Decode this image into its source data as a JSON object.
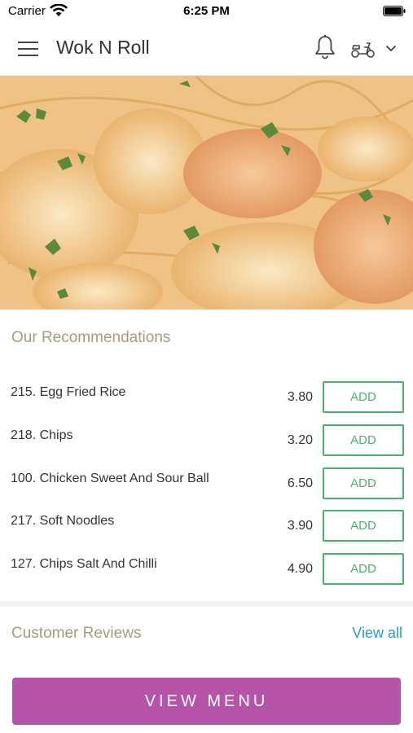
{
  "status_bar": {
    "carrier": "Carrier",
    "time": "6:25 PM"
  },
  "header": {
    "title": "Wok N Roll",
    "icons": [
      "menu-icon",
      "bell-icon",
      "scooter-icon",
      "chevron-down-icon"
    ]
  },
  "hero": {
    "image": "food-photo"
  },
  "recommendations": {
    "title": "Our Recommendations",
    "items": [
      {
        "name": "215. Egg Fried Rice",
        "price": "3.80",
        "action": "ADD"
      },
      {
        "name": "218. Chips",
        "price": "3.20",
        "action": "ADD"
      },
      {
        "name": "100. Chicken Sweet And Sour Ball",
        "price": "6.50",
        "action": "ADD"
      },
      {
        "name": "217. Soft Noodles",
        "price": "3.90",
        "action": "ADD"
      },
      {
        "name": "127. Chips Salt And Chilli",
        "price": "4.90",
        "action": "ADD"
      }
    ]
  },
  "reviews": {
    "title": "Customer Reviews",
    "view_all": "View all"
  },
  "footer": {
    "view_menu": "VIEW MENU"
  },
  "colors": {
    "accent_green": "#4caf6e",
    "section_title": "#a89a7e",
    "link_blue": "#2a9fc0",
    "button_purple": "#b654aa"
  }
}
